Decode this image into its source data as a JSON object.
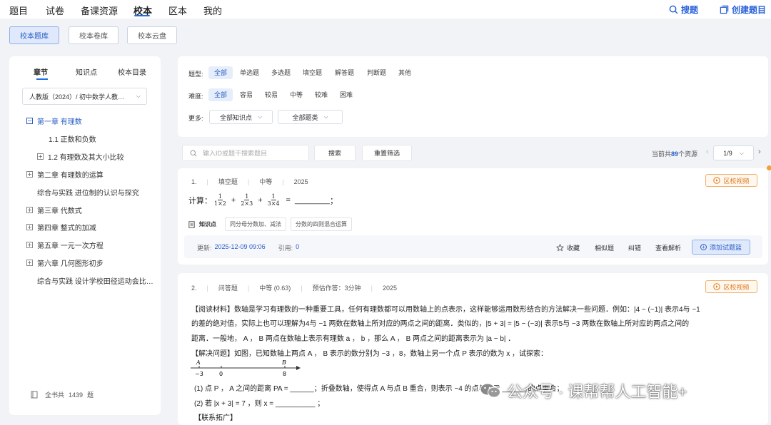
{
  "nav": {
    "items": [
      "题目",
      "试卷",
      "备课资源",
      "校本",
      "区本",
      "我的"
    ],
    "search_label": "搜题",
    "create_label": "创建题目"
  },
  "subtabs": [
    "校本题库",
    "校本卷库",
    "校本云盘"
  ],
  "sidebar": {
    "tabs": [
      "章节",
      "知识点",
      "校本目录"
    ],
    "book_select": "人教版（2024）/ 初中数学人教…",
    "tree": [
      {
        "label": "第一章 有理数",
        "toggle": "−",
        "selected": true
      },
      {
        "label": "1.1 正数和负数",
        "toggle": ""
      },
      {
        "label": "1.2 有理数及其大小比较",
        "toggle": "+"
      },
      {
        "label": "第二章 有理数的运算",
        "toggle": "+"
      },
      {
        "label": "综合与实践 进位制的认识与探究",
        "toggle": ""
      },
      {
        "label": "第三章 代数式",
        "toggle": "+"
      },
      {
        "label": "第四章 整式的加减",
        "toggle": "+"
      },
      {
        "label": "第五章 一元一次方程",
        "toggle": "+"
      },
      {
        "label": "第六章 几何图形初步",
        "toggle": "+"
      },
      {
        "label": "综合与实践 设计学校田径运动会比…",
        "toggle": ""
      }
    ],
    "footer_prefix": "全书共",
    "footer_count": "1439",
    "footer_suffix": "题"
  },
  "filters": {
    "type_label": "题型:",
    "types": [
      "全部",
      "单选题",
      "多选题",
      "填空题",
      "解答题",
      "判断题",
      "其他"
    ],
    "difficulty_label": "难度:",
    "difficulties": [
      "全部",
      "容易",
      "较易",
      "中等",
      "较难",
      "困难"
    ],
    "more_label": "更多:",
    "knowledge_dropdown": "全部知识点",
    "category_dropdown": "全部题类"
  },
  "search": {
    "placeholder": "输入ID或题干搜索题目",
    "search_button": "搜索",
    "reset_button": "重置筛选",
    "total_prefix": "当前共",
    "total_count": "89",
    "total_suffix": "个资源",
    "page": "1/9"
  },
  "q1": {
    "index": "1.",
    "type": "填空题",
    "level": "中等",
    "year": "2025",
    "video_button": "区校视频",
    "stem_prefix": "计算：",
    "fractions": [
      {
        "num": "1",
        "den": "1×2"
      },
      {
        "num": "1",
        "den": "2×3"
      },
      {
        "num": "1",
        "den": "3×4"
      }
    ],
    "plus": "+",
    "equals": "=",
    "blank": "________",
    "semicolon": "；",
    "kp_label": "知识点",
    "tags": [
      "同分母分数加、减法",
      "分数的四则混合运算"
    ],
    "updated_label": "更新:",
    "updated_value": "2025-12-09 09:06",
    "cite_label": "引用:",
    "cite_value": "0",
    "actions": [
      "收藏",
      "相似题",
      "纠错",
      "查看解析"
    ],
    "add_button": "添加试题篮"
  },
  "q2": {
    "index": "2.",
    "type": "问答题",
    "level": "中等 (0.63)",
    "time": "预估作答：3分钟",
    "year": "2025",
    "video_button": "区校视频",
    "line1": "【阅读材料】数轴是学习有理数的一种重要工具，任何有理数都可以用数轴上的点表示，这样能够运用数形结合的方法解决一些问题．例如：|4 − (−1)| 表示4与 −1",
    "line2": "的差的绝对值，实际上也可以理解为4与 −1 两数在数轴上所对应的两点之间的距离．类似的，|5 + 3| = |5 − (−3)| 表示5与 −3 两数在数轴上所对应的两点之间的",
    "line3": "距离．一般地， A ， B 两点在数轴上表示有理数 a ， b ，那么 A ， B 两点之间的距离表示为 |a − b| ．",
    "line4": "【解决问题】如图，已知数轴上两点 A ， B 表示的数分别为 −3 ，8，数轴上另一个点 P 表示的数为 x ，试探索：",
    "axis_labels": [
      "A",
      "B",
      "−3",
      "0",
      "8"
    ],
    "line5": "(1) 点 P ， A 之间的距离 PA = ______；折叠数轴，使得点 A 与点 B 重合，则表示 −4 的点与表示 ______ 的点重合；",
    "line6": "(2) 若 |x + 3| = 7 ，则 x = __________ ；",
    "line7": "【联系拓广】"
  },
  "watermark": "公众号 · 课帮帮人工智能+"
}
